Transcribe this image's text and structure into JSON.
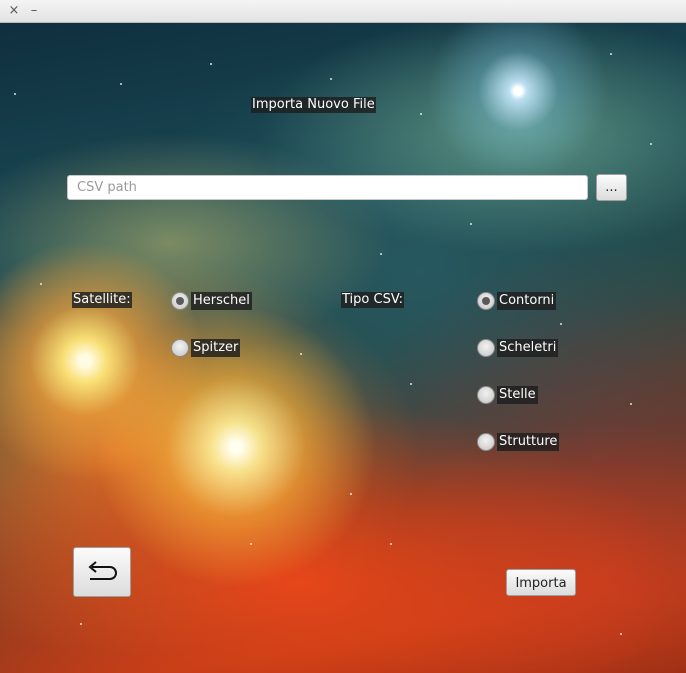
{
  "window": {
    "close_glyph": "×",
    "minimize_glyph": "–"
  },
  "title": "Importa Nuovo File",
  "csv": {
    "placeholder": "CSV path",
    "value": "",
    "browse_label": "..."
  },
  "satellite": {
    "label": "Satellite:",
    "options": [
      {
        "label": "Herschel",
        "selected": true
      },
      {
        "label": "Spitzer",
        "selected": false
      }
    ]
  },
  "tipo_csv": {
    "label": "Tipo CSV:",
    "options": [
      {
        "label": "Contorni",
        "selected": true
      },
      {
        "label": "Scheletri",
        "selected": false
      },
      {
        "label": "Stelle",
        "selected": false
      },
      {
        "label": "Strutture",
        "selected": false
      }
    ]
  },
  "back_icon": "return-arrow-icon",
  "import_label": "Importa"
}
